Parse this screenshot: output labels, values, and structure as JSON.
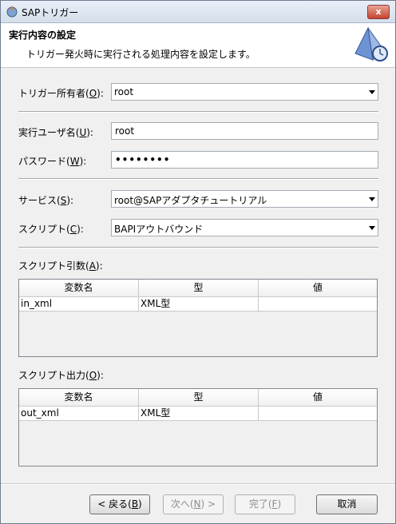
{
  "window": {
    "title": "SAPトリガー",
    "close_label": "x"
  },
  "header": {
    "title": "実行内容の設定",
    "description": "トリガー発火時に実行される処理内容を設定します。"
  },
  "form": {
    "owner": {
      "label_pre": "トリガー所有者(",
      "mnemonic": "O",
      "label_post": "):",
      "value": "root"
    },
    "exec_user": {
      "label_pre": "実行ユーザ名(",
      "mnemonic": "U",
      "label_post": "):",
      "value": "root"
    },
    "password": {
      "label_pre": "パスワード(",
      "mnemonic": "W",
      "label_post": "):",
      "value": "••••••••"
    },
    "service": {
      "label_pre": "サービス(",
      "mnemonic": "S",
      "label_post": "):",
      "value": "root@SAPアダプタチュートリアル"
    },
    "script": {
      "label_pre": "スクリプト(",
      "mnemonic": "C",
      "label_post": "):",
      "value": "BAPIアウトバウンド"
    }
  },
  "args_table": {
    "label_pre": "スクリプト引数(",
    "mnemonic": "A",
    "label_post": "):",
    "columns": [
      "変数名",
      "型",
      "値"
    ],
    "rows": [
      {
        "name": "in_xml",
        "type": "XML型",
        "value": ""
      }
    ]
  },
  "output_table": {
    "label_pre": "スクリプト出力(",
    "mnemonic": "O",
    "label_post": "):",
    "columns": [
      "変数名",
      "型",
      "値"
    ],
    "rows": [
      {
        "name": "out_xml",
        "type": "XML型",
        "value": ""
      }
    ]
  },
  "buttons": {
    "back": {
      "pre": "< 戻る(",
      "mnemonic": "B",
      "post": ")"
    },
    "next": {
      "pre": "次へ(",
      "mnemonic": "N",
      "post": ") >"
    },
    "finish": {
      "pre": "完了(",
      "mnemonic": "F",
      "post": ")"
    },
    "cancel": "取消"
  }
}
